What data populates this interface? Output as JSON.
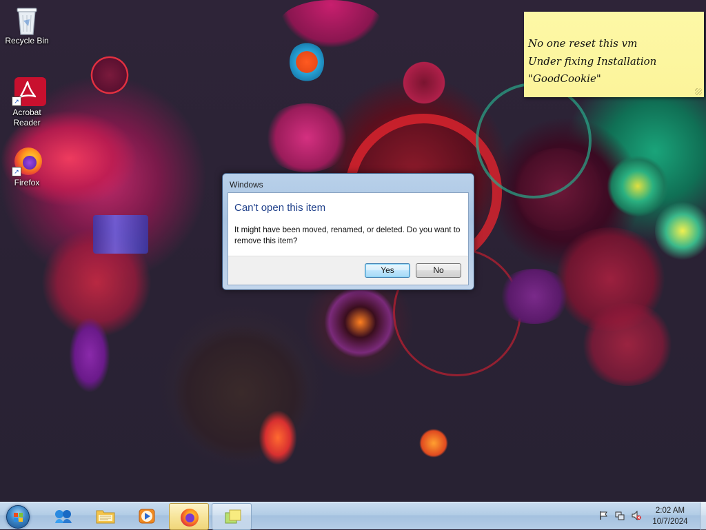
{
  "desktop": {
    "icons": [
      {
        "label": "Recycle Bin"
      },
      {
        "label": "Acrobat Reader"
      },
      {
        "label": "Firefox"
      }
    ]
  },
  "sticky_note": {
    "lines": [
      "No one reset this vm",
      "Under fixing Installation",
      "\"GoodCookie\""
    ]
  },
  "dialog": {
    "title": "Windows",
    "main_instruction": "Can't open this item",
    "message": "It might have been moved, renamed, or deleted. Do you want to remove this item?",
    "buttons": {
      "yes": "Yes",
      "no": "No"
    }
  },
  "taskbar": {
    "pinned": [
      {
        "name": "Windows Live"
      },
      {
        "name": "Windows Explorer"
      },
      {
        "name": "Windows Media Player"
      },
      {
        "name": "Firefox",
        "state": "active"
      },
      {
        "name": "Sticky Notes",
        "state": "open"
      }
    ],
    "tray_icons": [
      "action-center-flag",
      "network",
      "volume-muted"
    ],
    "clock": {
      "time": "2:02 AM",
      "date": "10/7/2024"
    }
  },
  "colors": {
    "dialog_instruction": "#1e3f8a",
    "sticky_note": "#fcf49a",
    "taskbar": "#b3cde6"
  }
}
